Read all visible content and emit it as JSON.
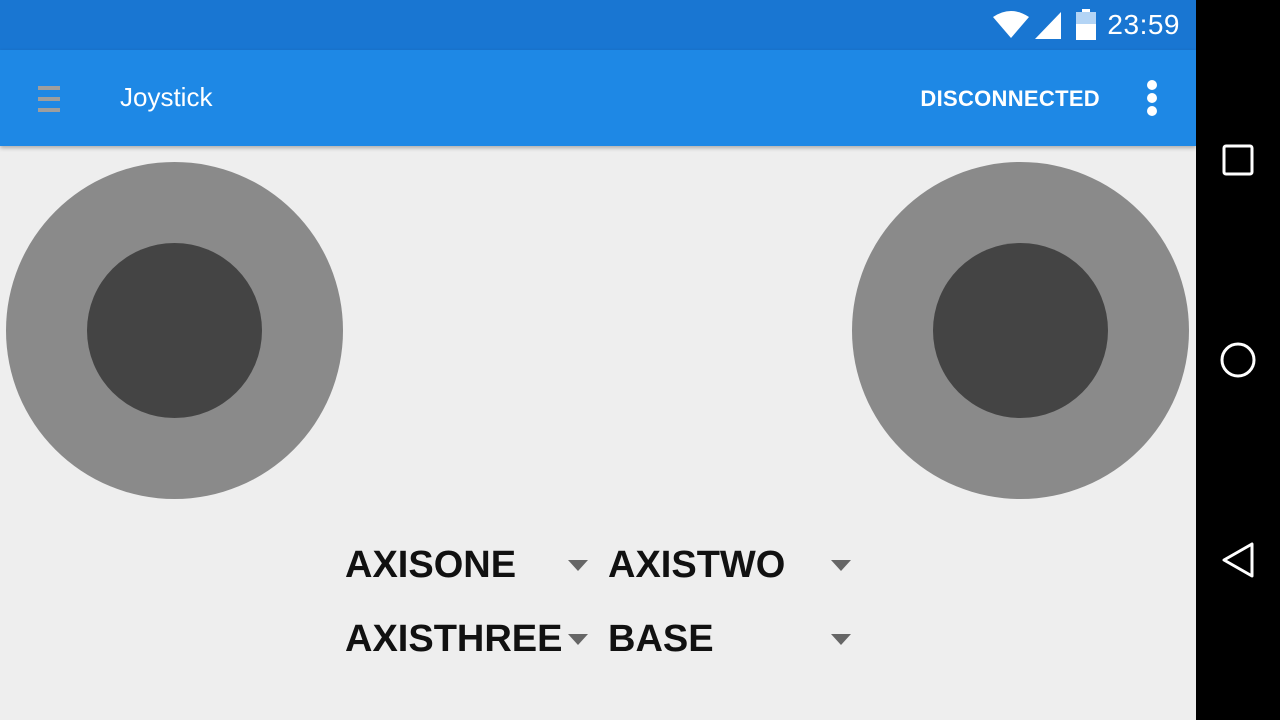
{
  "status_bar": {
    "time": "23:59",
    "icons": [
      "wifi-icon",
      "cell-signal-icon",
      "battery-icon"
    ]
  },
  "app_bar": {
    "title": "Joystick",
    "connection_status": "DISCONNECTED",
    "icons": [
      "menu-icon",
      "overflow-menu-icon"
    ]
  },
  "spinners": [
    {
      "label": "AXISONE"
    },
    {
      "label": "AXISTWO"
    },
    {
      "label": "AXISTHREE"
    },
    {
      "label": "BASE"
    }
  ],
  "nav_bar": {
    "icons": [
      "recents-icon",
      "home-icon",
      "back-icon"
    ]
  },
  "colors": {
    "status_bar": "#1976d2",
    "app_bar": "#1e88e5",
    "background": "#eeeeee",
    "joystick_base": "#8a8a8a",
    "joystick_knob": "#444444"
  }
}
